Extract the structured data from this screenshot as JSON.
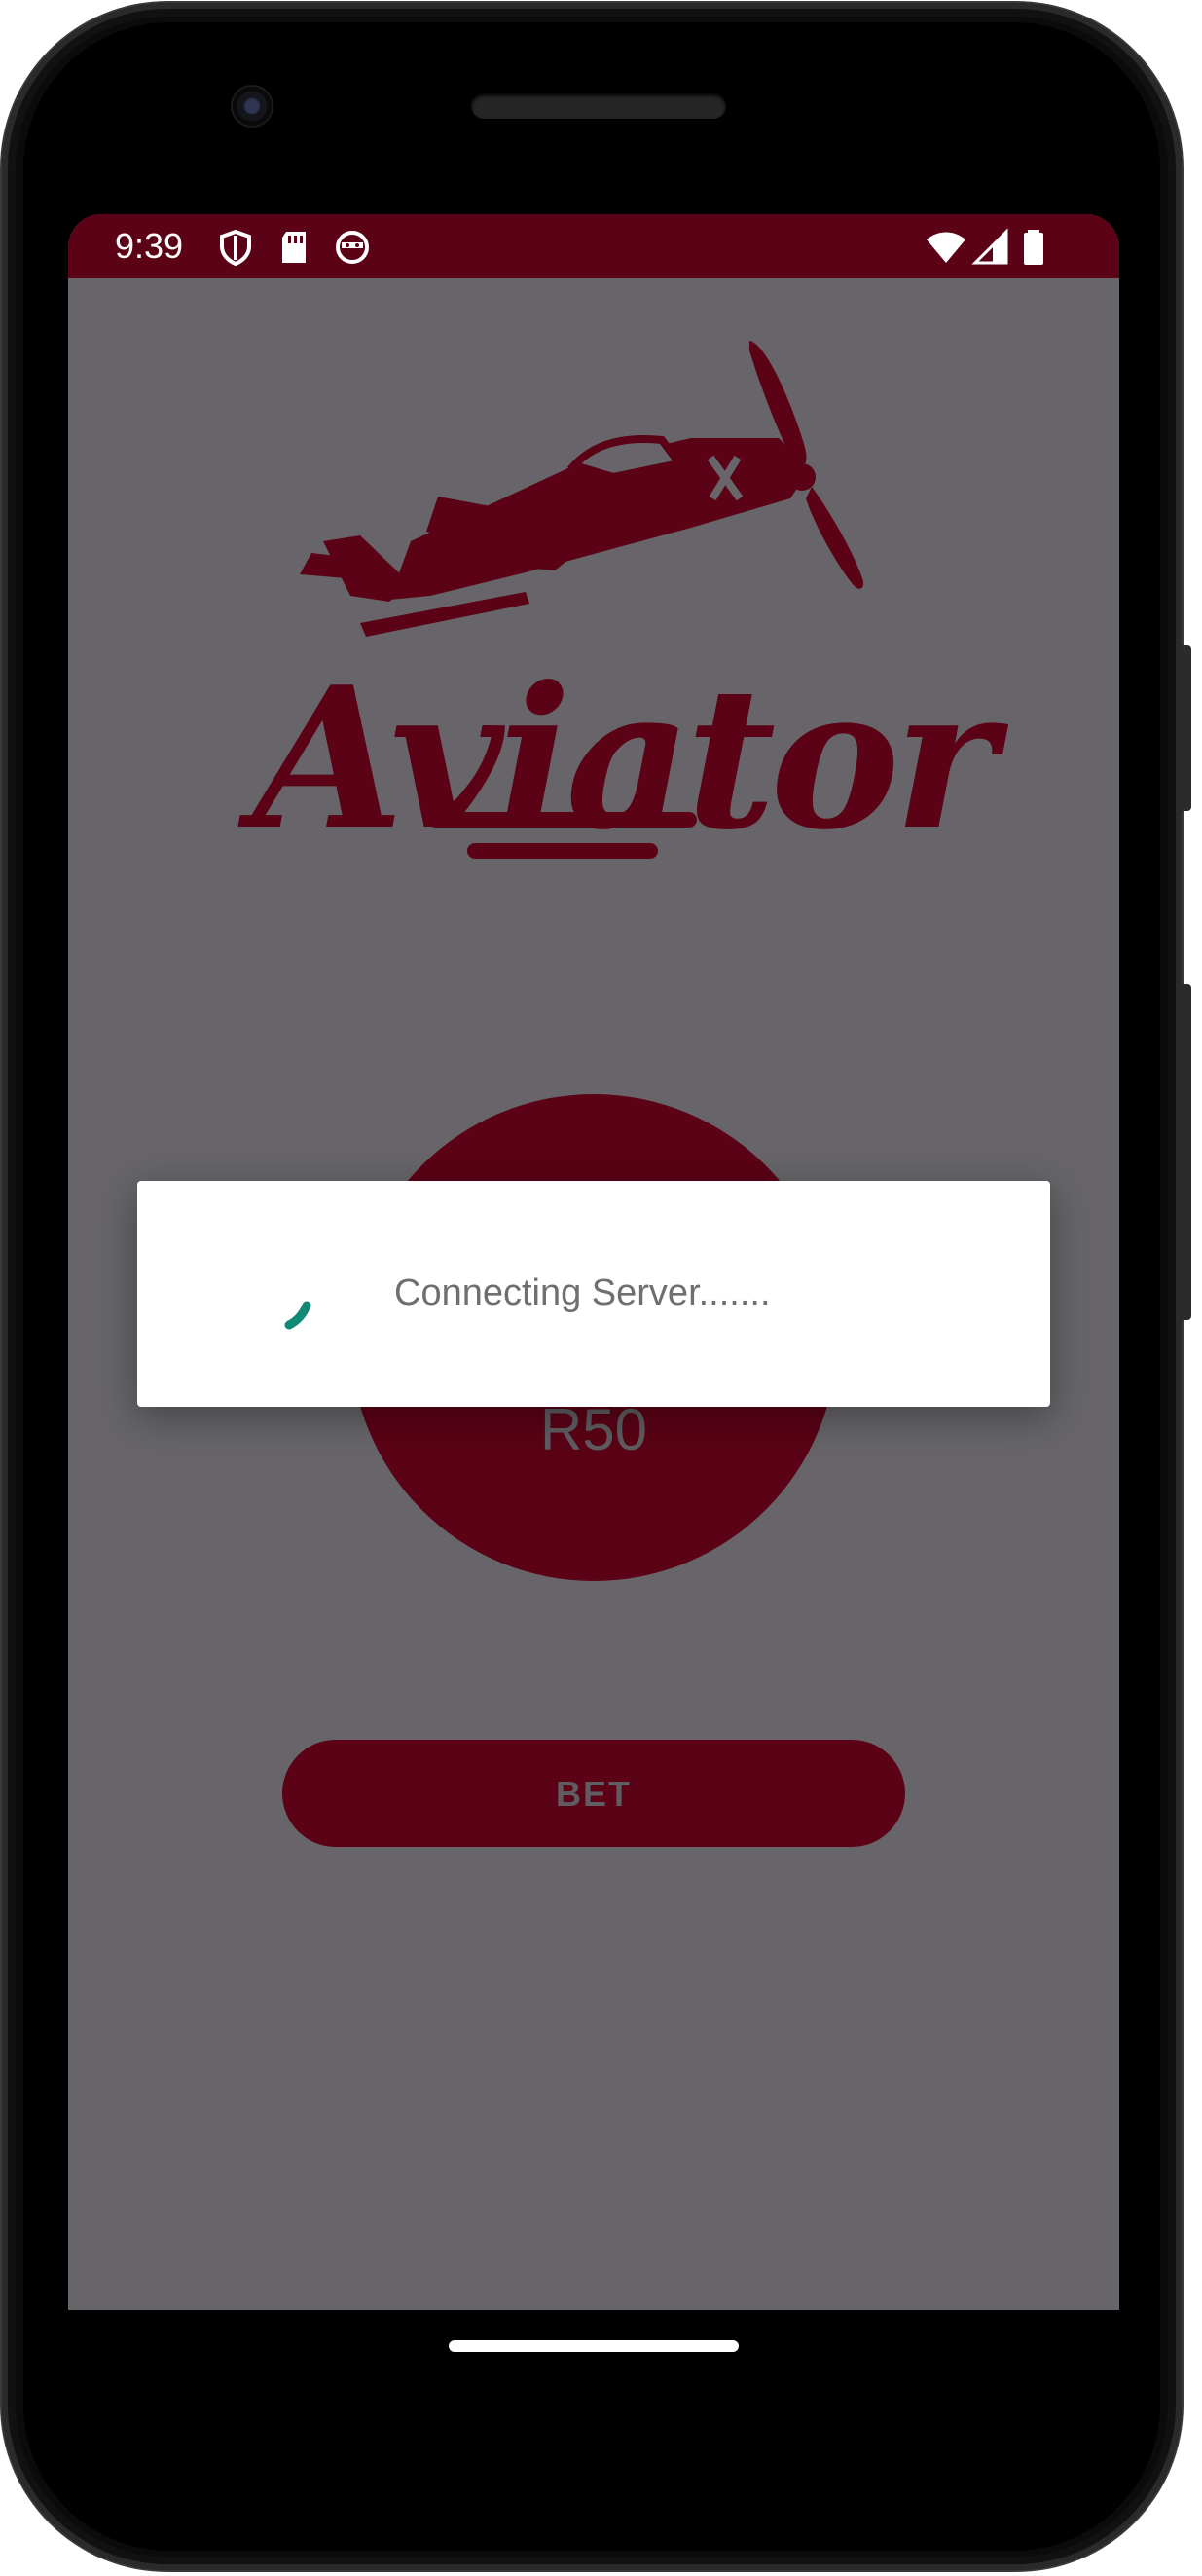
{
  "status_bar": {
    "time": "9:39",
    "left_icons": [
      "shield-icon",
      "sd-card-icon",
      "face-icon"
    ],
    "right_icons": [
      "wifi-icon",
      "signal-icon",
      "battery-icon"
    ],
    "background_color": "#5b0216"
  },
  "app": {
    "logo_text": "Aviator",
    "stake_amount": "R50",
    "bet_label": "BET",
    "accent_color": "#5b0216",
    "background_color": "#676569"
  },
  "dialog": {
    "message": "Connecting Server.......",
    "spinner_color": "#0f8a77"
  }
}
